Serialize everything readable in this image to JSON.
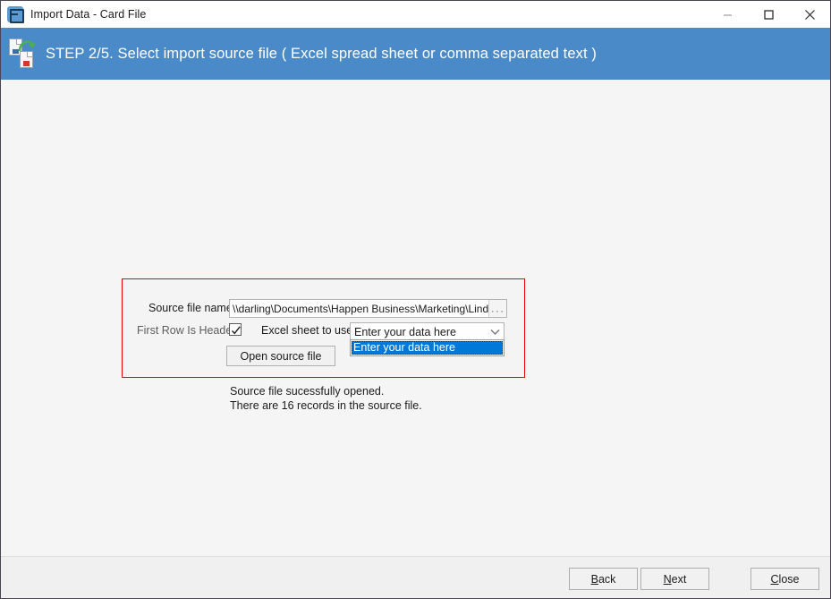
{
  "window": {
    "title": "Import Data - Card File",
    "app_icon": "app-database-icon",
    "controls": {
      "minimize": "minimize-icon",
      "maximize": "maximize-icon",
      "close": "close-icon"
    }
  },
  "banner": {
    "icon": "import-documents-icon",
    "title": "STEP 2/5. Select import source file ( Excel spread sheet or comma separated text )",
    "color": "#4a8ac9"
  },
  "panel": {
    "border_color": "#ed0000",
    "source_file": {
      "label": "Source file name",
      "value": "\\\\darling\\Documents\\Happen Business\\Marketing\\Linda\\Dat",
      "browse_label": "···"
    },
    "first_row_header": {
      "label": "First Row Is Header",
      "checked": true,
      "check_icon": "checkmark-icon"
    },
    "excel_sheet": {
      "label": "Excel sheet to use",
      "value": "Enter your data here",
      "chevron_icon": "chevron-down-icon",
      "options": [
        "Enter your data here"
      ],
      "highlight_color": "#0078d7"
    },
    "open_button": "Open source file"
  },
  "status": {
    "line1": "Source file sucessfully opened.",
    "line2": "There are 16 records in the source file."
  },
  "footer": {
    "back": {
      "accel": "B",
      "rest": "ack"
    },
    "next": {
      "accel": "N",
      "rest": "ext"
    },
    "close": {
      "accel": "C",
      "rest": "lose"
    }
  }
}
